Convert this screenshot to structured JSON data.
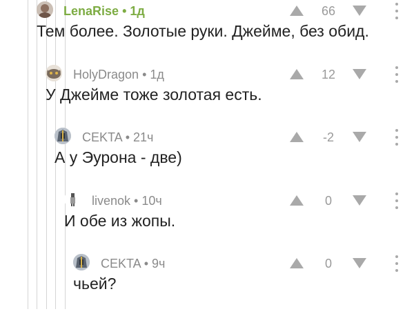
{
  "comments": [
    {
      "author": "LenaRise",
      "separator": "•",
      "time": "1д",
      "score": "66",
      "text": "Тем более. Золотые руки. Джейме, без обид.",
      "author_color": "#7dac43"
    },
    {
      "author": "HolyDragon",
      "separator": "•",
      "time": "1д",
      "score": "12",
      "text": "У Джейме тоже золотая есть."
    },
    {
      "author": "CEKTA",
      "separator": "•",
      "time": "21ч",
      "score": "-2",
      "text": "А у Эурона - две)"
    },
    {
      "author": "livenok",
      "separator": "•",
      "time": "10ч",
      "score": "0",
      "text": "И обе из жопы."
    },
    {
      "author": "CEKTA",
      "separator": "•",
      "time": "9ч",
      "score": "0",
      "text": "чьей?"
    }
  ],
  "icons": {
    "upvote": "upvote-arrow-icon",
    "downvote": "downvote-arrow-icon",
    "more": "more-vertical-icon"
  },
  "colors": {
    "thread_line": "#d4d4d4",
    "icon_gray": "#a9a9a9",
    "meta_gray": "#8a8a8a",
    "accent_green": "#7dac43"
  }
}
